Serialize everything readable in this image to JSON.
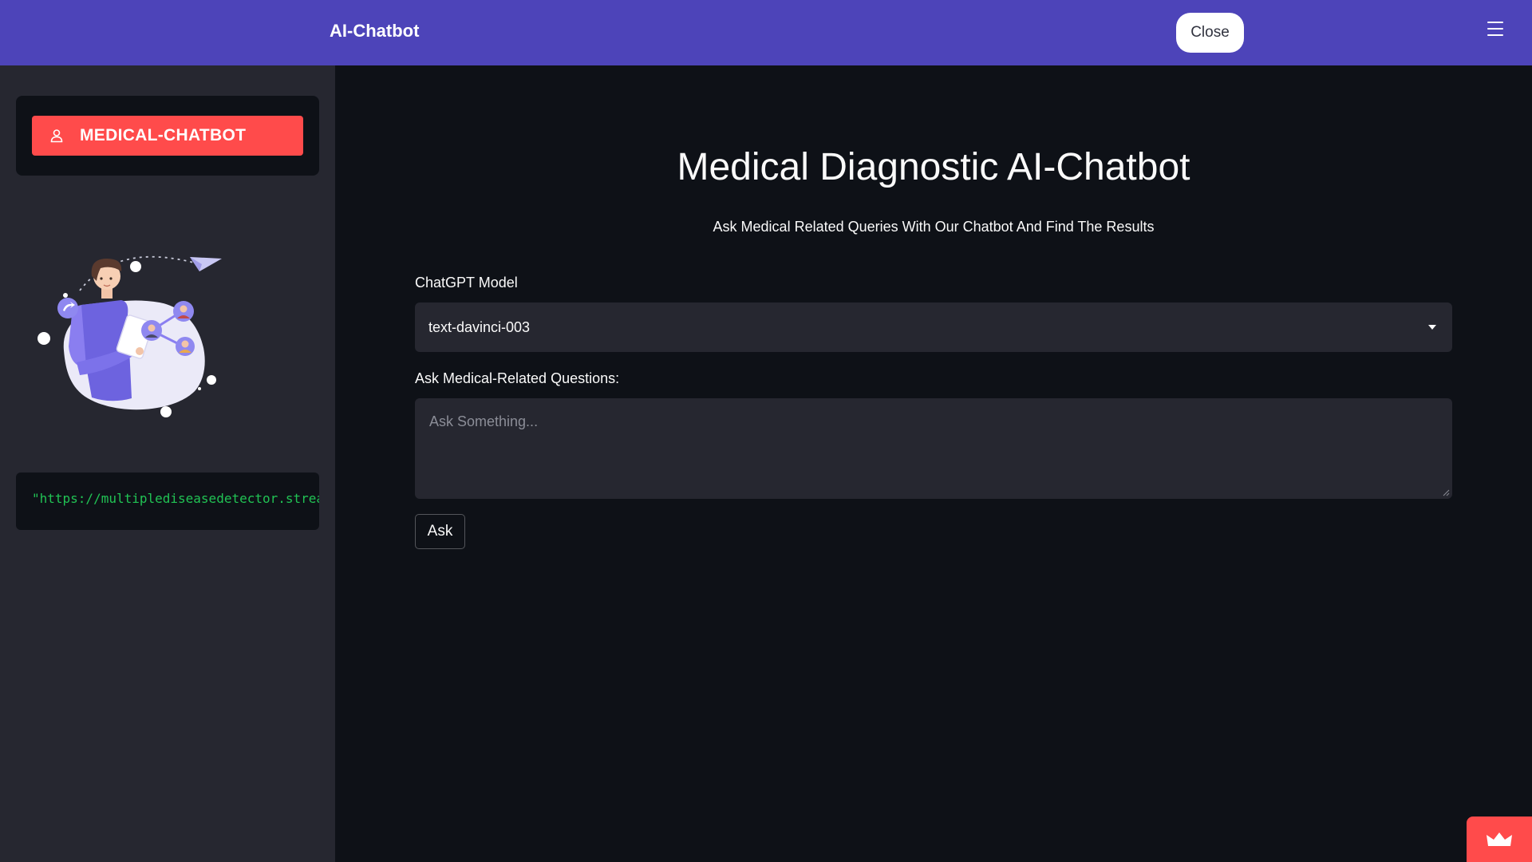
{
  "header": {
    "title": "AI-Chatbot",
    "close_label": "Close",
    "menu_icon": "hamburger-icon",
    "background": "#4d44b9"
  },
  "sidebar": {
    "nav_items": [
      {
        "label": "MEDICAL-CHATBOT",
        "icon": "person-icon",
        "selected": true
      }
    ],
    "illustration": "person-with-tablet-network-illustration",
    "code_text": "\"https://multiplediseasedetector.streamlit.app/\""
  },
  "main": {
    "title": "Medical Diagnostic AI-Chatbot",
    "subtitle": "Ask Medical Related Queries With Our Chatbot And Find The Results",
    "model_label": "ChatGPT Model",
    "model_value": "text-davinci-003",
    "question_label": "Ask Medical-Related Questions:",
    "question_placeholder": "Ask Something...",
    "question_value": "",
    "ask_label": "Ask"
  },
  "footer": {
    "badge_icon": "crown-icon"
  },
  "colors": {
    "accent": "#ff4b4b",
    "background": "#0e1117",
    "sidebar": "#262730",
    "code": "#21c354"
  }
}
